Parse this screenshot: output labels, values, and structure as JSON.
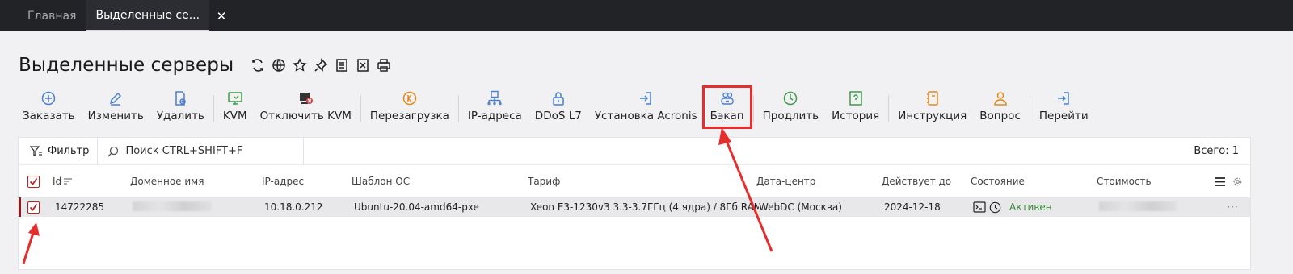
{
  "tabs": [
    {
      "label": "Главная",
      "active": false
    },
    {
      "label": "Выделенные се...",
      "active": true
    }
  ],
  "tab_close": "✕",
  "page_title": "Выделенные серверы",
  "toolbar": {
    "order": "Заказать",
    "edit": "Изменить",
    "delete": "Удалить",
    "kvm": "KVM",
    "kvm_off": "Отключить KVM",
    "reboot": "Перезагрузка",
    "ip": "IP-адреса",
    "ddos": "DDoS L7",
    "acronis": "Установка Acronis",
    "backup": "Бэкап",
    "renew": "Продлить",
    "history": "История",
    "instruction": "Инструкция",
    "question": "Вопрос",
    "goto": "Перейти"
  },
  "filter": {
    "filter_label": "Фильтр",
    "search_label": "Поиск CTRL+SHIFT+F",
    "total": "Всего: 1"
  },
  "table": {
    "headers": {
      "id": "Id",
      "domain": "Доменное имя",
      "ip": "IP-адрес",
      "os": "Шаблон ОС",
      "tariff": "Тариф",
      "dc": "Дата-центр",
      "valid": "Действует до",
      "state": "Состояние",
      "cost": "Стоимость"
    },
    "rows": [
      {
        "id": "14722285",
        "ip": "10.18.0.212",
        "os": "Ubuntu-20.04-amd64-pxe",
        "tariff": "Xeon E3-1230v3 3.3-3.7ГГц (4 ядра) / 8Гб RAM / ...",
        "dc": "WebDC (Москва)",
        "valid": "2024-12-18",
        "state": "Активен",
        "more": "···"
      }
    ]
  },
  "colors": {
    "annotation": "#e52d2d",
    "active_state": "#3c8b3c",
    "icon_blue": "#4a7fd0",
    "icon_green": "#3f9a4a",
    "icon_orange": "#e08a1e"
  }
}
